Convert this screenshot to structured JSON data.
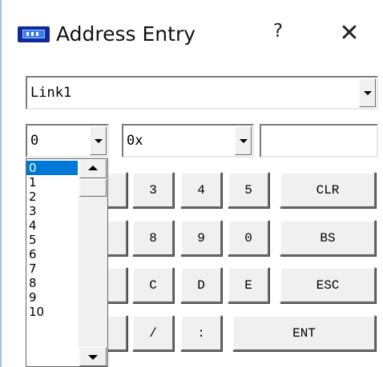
{
  "window": {
    "title": "Address Entry",
    "help_label": "?",
    "close_label": "✕"
  },
  "link_combo": {
    "value": "Link1"
  },
  "station_combo": {
    "value": "0"
  },
  "prefix_combo": {
    "value": "0x"
  },
  "address_input": {
    "value": ""
  },
  "keypad": {
    "row1": [
      "3",
      "4",
      "5",
      "CLR"
    ],
    "row2": [
      "8",
      "9",
      "0",
      "BS"
    ],
    "row3": [
      "C",
      "D",
      "E",
      "ESC"
    ],
    "row4": [
      "/",
      ":",
      "ENT"
    ]
  },
  "dropdown": {
    "items": [
      "0",
      "1",
      "2",
      "3",
      "4",
      "5",
      "6",
      "7",
      "8",
      "9",
      "10"
    ],
    "selected_index": 0
  },
  "icons": {
    "window_icon": "hmi-screen-icon",
    "help": "help-icon",
    "close": "close-icon",
    "scroll_up": "scroll-up-arrow-icon",
    "scroll_down": "scroll-down-arrow-icon"
  },
  "colors": {
    "selection": "#0078d7",
    "window_border": "#9ec3e6",
    "icon_blue": "#0f2a9c"
  }
}
